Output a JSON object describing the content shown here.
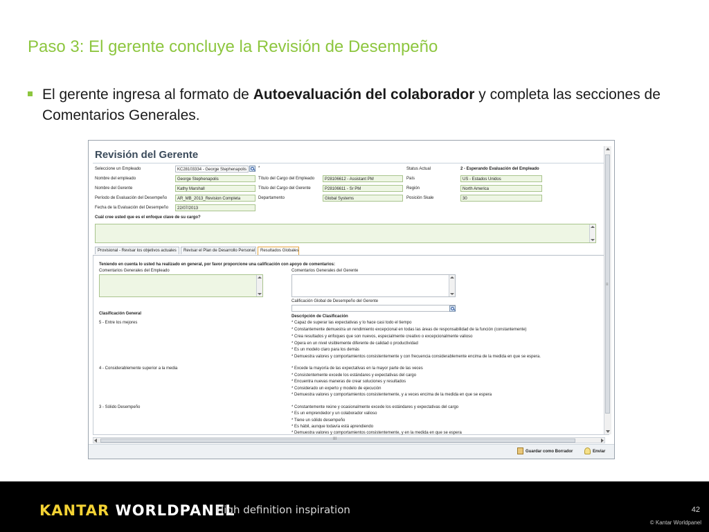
{
  "slide": {
    "title": "Paso 3: El gerente concluye la Revisión de Desempeño",
    "bullet": {
      "before": "El  gerente ingresa al formato de ",
      "bold": "Autoevaluación del colaborador",
      "after": " y completa las secciones de Comentarios Generales."
    }
  },
  "form": {
    "title": "Revisión del Gerente",
    "fields": {
      "employee_select_label": "Seleccione un Empleado",
      "employee_select_value": "KC28103334 - George Stephenapolis",
      "required_mark": "*",
      "status_label": "Status Actual",
      "status_value": "2 - Esperando Evaluación del Empleado",
      "employee_name_label": "Nombre del empleado",
      "employee_name_value": "George Stephenapolis",
      "employee_job_title_label": "Título del Cargo del Empleado",
      "employee_job_title_value": "P28106612 - Assistant PM",
      "country_label": "País",
      "country_value": "US - Estados Unidos",
      "manager_name_label": "Nombre del Gerente",
      "manager_name_value": "Kathy Marshall",
      "manager_job_title_label": "Título del Cargo del Gerente",
      "manager_job_title_value": "P28106611 - Sr PM",
      "region_label": "Región",
      "region_value": "North America",
      "period_label": "Período de Evaluación del Desempeño",
      "period_value": "AR_MB_2013_Revision Completa",
      "department_label": "Departamento",
      "department_value": "Global Systems",
      "position_scale_label": "Posición Skale",
      "position_scale_value": "30",
      "eval_date_label": "Fecha de la Evaluación del Desempeño",
      "eval_date_value": "22/07/2013",
      "key_focus_question": "Cuál cree usted que es el enfoque clave de su cargo?"
    },
    "tabs": [
      "Provisional - Revisar los objetivos actuales",
      "Revisar el Plan de Desarrollo Personal",
      "Resultados Globales"
    ],
    "panel": {
      "intro": "Teniendo en cuenta lo usted ha realizado en general, por favor proporcione una calificación con apoyo de comentarios:",
      "employee_comments_label": "Comentarios Generales del Empleado",
      "manager_comments_label": "Comentarios Generales del Gerente",
      "overall_rating_label": "Calificación Global de Desempeño del Gerente",
      "classification_header": "Clasificación General",
      "description_header": "Descripción de Clasificación",
      "levels": [
        {
          "name": "5 - Entre los mejores",
          "items": [
            "* Capaz de superar las expectativas y lo hace casi todo el tiempo",
            "* Constantemente demuestra un rendimiento excepcional en todas las áreas de responsabilidad de la función (constantemente)",
            "* Crea resultados y enfoques que son nuevos, especialmente creativo o excepcionalmente valioso",
            "* Opera en un nivel visiblemente diferente de calidad o productividad",
            "* Es un modelo claro para los demás",
            "* Demuestra valores y comportamientos consistentemente y con frecuencia considerablemente encima de la medida en que se espera."
          ]
        },
        {
          "name": "4 - Considerablemente superior a la media",
          "items": [
            "* Excede la mayoría de las expectativas en la mayor parte de las veces",
            "* Consistentemente excede los estándares y expectativas del cargo",
            "* Encuentra nuevas maneras de crear soluciones y resultados",
            "* Considerado un experto y modelo de ejecución",
            "* Demuestra valores y comportamientos consistentemente, y a veces encima de la medida en que se espera"
          ]
        },
        {
          "name": "3 - Sólido Desempeño",
          "items": [
            "* Constantemente reúne y ocasionalmente excede los estándares y expectativas del cargo",
            "* Es un emprendedor y un colaborador valioso",
            "* Tiene un sólido desempeño",
            "* Es hábil, aunque todavía está aprendiendo",
            "* Demuestra valores y comportamientos consistentemente, y en la medida en que se espera"
          ]
        }
      ]
    },
    "scroll_grip": "≡",
    "hscroll_grip": "III",
    "buttons": {
      "save_draft": "Guardar como Borrador",
      "send": "Enviar"
    }
  },
  "footer": {
    "logo_part1": "KANTAR ",
    "logo_part2": "WORLDPANEL",
    "tagline": "High definition inspiration",
    "page_number": "42",
    "copyright": "© Kantar Worldpanel"
  },
  "colors": {
    "accent_green": "#8dc63f",
    "field_green": "#eef6e4",
    "footer_black": "#000000",
    "logo_yellow": "#f3d234"
  }
}
